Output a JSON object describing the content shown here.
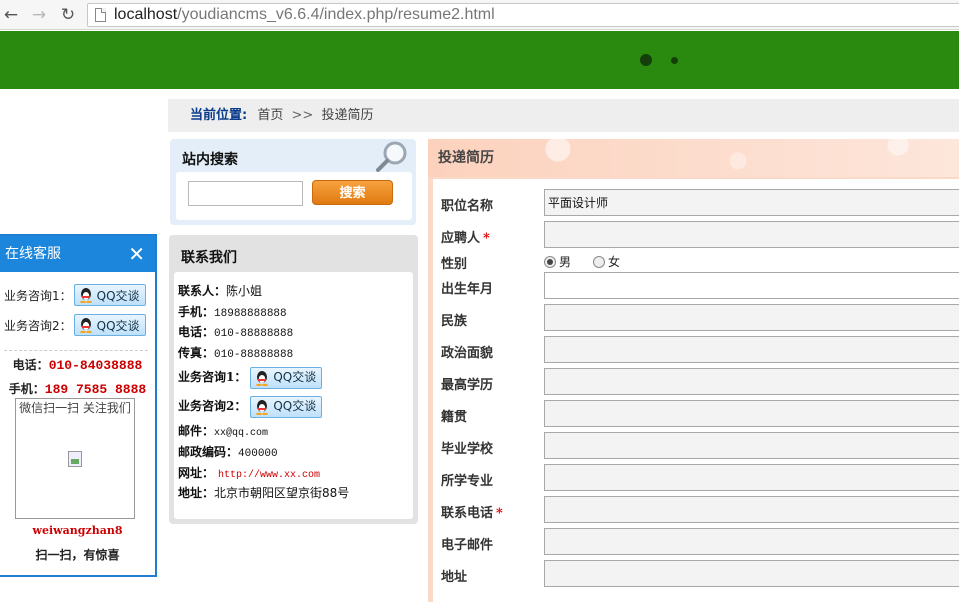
{
  "browser": {
    "url_host": "localhost",
    "url_path": "/youdiancms_v6.6.4/index.php/resume2.html"
  },
  "breadcrumb": {
    "label": "当前位置:",
    "home": "首页",
    "separator": ">>",
    "current": "投递简历"
  },
  "search": {
    "title": "站内搜索",
    "input_value": "",
    "button_label": "搜索"
  },
  "contact": {
    "title": "联系我们",
    "rows": [
      {
        "label": "联系人：",
        "value": "陈小姐"
      },
      {
        "label": "手机：",
        "value": "18988888888"
      },
      {
        "label": "电话：",
        "value": "010-88888888"
      },
      {
        "label": "传真：",
        "value": "010-88888888"
      },
      {
        "label": "业务咨询1：",
        "value": "QQ交谈"
      },
      {
        "label": "业务咨询2：",
        "value": "QQ交谈"
      },
      {
        "label": "邮件：",
        "value": "xx@qq.com"
      },
      {
        "label": "邮政编码：",
        "value": "400000"
      },
      {
        "label": "网址：",
        "value": "http://www.xx.com"
      },
      {
        "label": "地址：",
        "value": "北京市朝阳区望京街88号"
      }
    ]
  },
  "service": {
    "title": "在线客服",
    "close": "✕",
    "consult1": "业务咨询1：",
    "consult2": "业务咨询2：",
    "qq_label": "QQ交谈",
    "phone_label": "电话：",
    "phone": "010-84038888",
    "mobile_label": "手机：",
    "mobile": "189 7585 8888",
    "qr_caption": "微信扫一扫 关注我们",
    "wechat_id": "weiwangzhan8",
    "tip": "扫一扫，有惊喜"
  },
  "form": {
    "title": "投递简历",
    "fields": [
      {
        "label": "职位名称",
        "required": false,
        "value": "平面设计师"
      },
      {
        "label": "应聘人",
        "required": true,
        "value": ""
      },
      {
        "label": "性别",
        "required": false,
        "value": ""
      },
      {
        "label": "出生年月",
        "required": false,
        "value": ""
      },
      {
        "label": "民族",
        "required": false,
        "value": ""
      },
      {
        "label": "政治面貌",
        "required": false,
        "value": ""
      },
      {
        "label": "最高学历",
        "required": false,
        "value": ""
      },
      {
        "label": "籍贯",
        "required": false,
        "value": ""
      },
      {
        "label": "毕业学校",
        "required": false,
        "value": ""
      },
      {
        "label": "所学专业",
        "required": false,
        "value": ""
      },
      {
        "label": "联系电话",
        "required": true,
        "value": ""
      },
      {
        "label": "电子邮件",
        "required": false,
        "value": ""
      },
      {
        "label": "地址",
        "required": false,
        "value": ""
      }
    ],
    "gender_options": [
      "男",
      "女"
    ],
    "gender_selected": "男",
    "required_mark": "*"
  },
  "colors": {
    "banner_green": "#2a8a10",
    "service_blue": "#1b86dc",
    "search_orange": "#e88418",
    "accent_red": "#cc0000"
  }
}
